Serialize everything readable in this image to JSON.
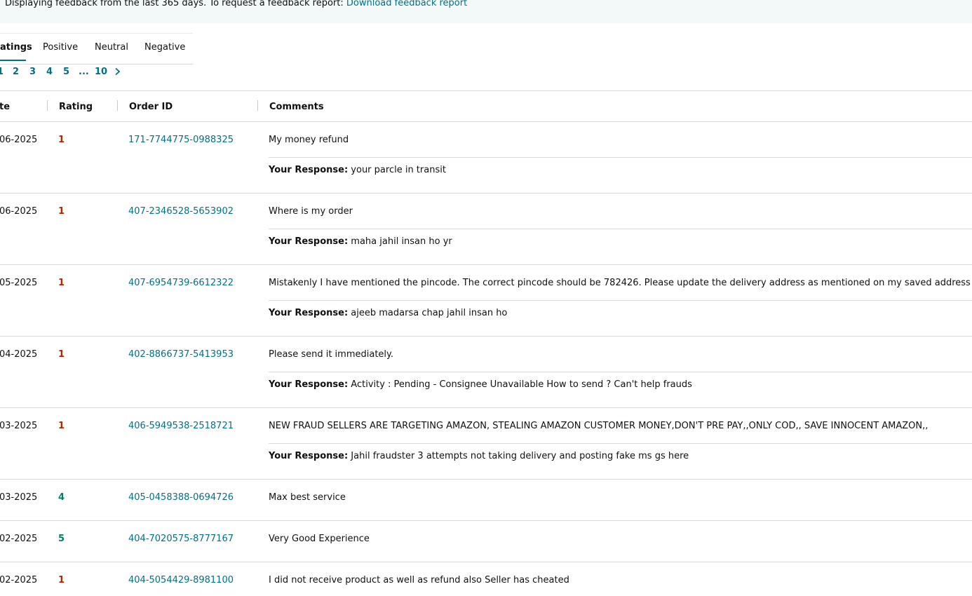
{
  "banner": {
    "text": "Displaying feedback from the last 365 days. To request a feedback report:",
    "link": "Download feedback report"
  },
  "tabs": [
    {
      "label": "atings",
      "active": true
    },
    {
      "label": "Positive",
      "active": false
    },
    {
      "label": "Neutral",
      "active": false
    },
    {
      "label": "Negative",
      "active": false
    }
  ],
  "pagination": {
    "pages": [
      "1",
      "2",
      "3",
      "4",
      "5",
      "...",
      "10"
    ],
    "next_icon": "chevron-right-icon"
  },
  "table": {
    "headers": {
      "date": "te",
      "rating": "Rating",
      "order_id": "Order ID",
      "comments": "Comments"
    },
    "response_label": "Your Response:",
    "rows": [
      {
        "date": "06-2025",
        "rating": "1",
        "order_id": "171-7744775-0988325",
        "comment": "My money refund",
        "response": "your parcle in transit"
      },
      {
        "date": "06-2025",
        "rating": "1",
        "order_id": "407-2346528-5653902",
        "comment": "Where is my order",
        "response": "maha jahil insan ho yr"
      },
      {
        "date": "05-2025",
        "rating": "1",
        "order_id": "407-6954739-6612322",
        "comment": "Mistakenly I have mentioned the pincode. The correct pincode should be 782426. Please update the delivery address as mentioned on my saved address",
        "response": "ajeeb madarsa chap jahil insan ho"
      },
      {
        "date": "04-2025",
        "rating": "1",
        "order_id": "402-8866737-5413953",
        "comment": "Please send it immediately.",
        "response": "Activity : Pending - Consignee Unavailable How to send ? Can't help frauds"
      },
      {
        "date": "03-2025",
        "rating": "1",
        "order_id": "406-5949538-2518721",
        "comment": "NEW FRAUD SELLERS ARE TARGETING AMAZON, STEALING AMAZON CUSTOMER MONEY,DON'T PRE PAY,,ONLY COD,, SAVE INNOCENT AMAZON,,",
        "response": "Jahil fraudster 3 attempts not taking delivery and posting fake ms gs here"
      },
      {
        "date": "03-2025",
        "rating": "4",
        "order_id": "405-0458388-0694726",
        "comment": "Max best service",
        "response": null
      },
      {
        "date": "02-2025",
        "rating": "5",
        "order_id": "404-7020575-8777167",
        "comment": "Very Good Experience",
        "response": null
      },
      {
        "date": "02-2025",
        "rating": "1",
        "order_id": "404-5054429-8981100",
        "comment": "I did not receive product as well as refund also Seller has cheated",
        "response": null
      }
    ]
  },
  "colors": {
    "link": "#007185",
    "rating_low": "#b12704",
    "rating_high": "#067d62",
    "banner_bg": "#f3f8f8"
  }
}
